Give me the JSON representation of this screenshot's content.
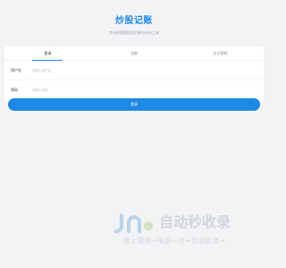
{
  "header": {
    "title": "炒股记账",
    "subtitle": "专业的股票投资记账与分析工具"
  },
  "tabs": [
    {
      "label": "登录",
      "active": true
    },
    {
      "label": "注册",
      "active": false
    },
    {
      "label": "忘记密码",
      "active": false
    }
  ],
  "form": {
    "username": {
      "label": "用户名",
      "placeholder": "请输入用户名",
      "value": ""
    },
    "password": {
      "label": "密码",
      "placeholder": "请输入密码",
      "value": ""
    }
  },
  "login_button": {
    "label": "登录"
  },
  "watermark": {
    "title": "自动秒收录",
    "slogan": "放上链接→来访一次→自动收录→",
    "logo_icon": "link-logo-icon"
  },
  "colors": {
    "accent": "#1e88e5",
    "background": "#f2f3f5"
  }
}
